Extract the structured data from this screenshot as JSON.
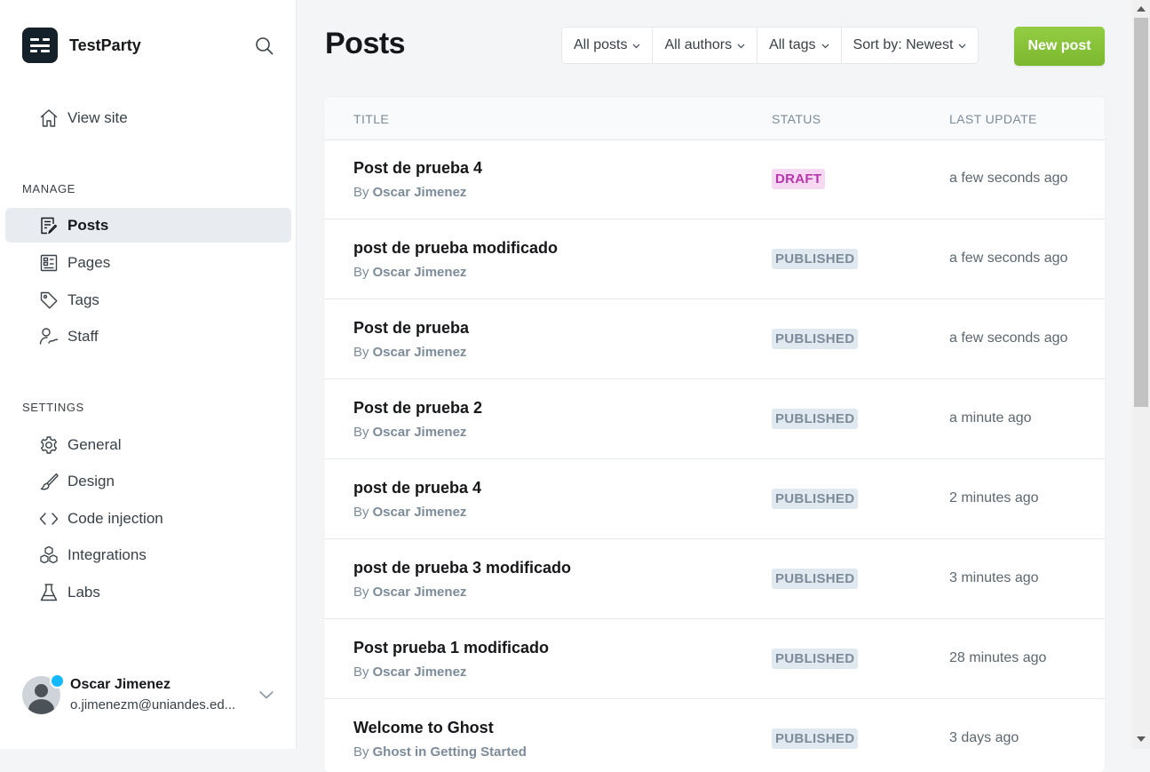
{
  "app": {
    "site_name": "TestParty"
  },
  "sidebar": {
    "view_site": "View site",
    "manage_label": "MANAGE",
    "manage_items": [
      {
        "label": "Posts",
        "icon": "posts-icon",
        "active": true
      },
      {
        "label": "Pages",
        "icon": "pages-icon"
      },
      {
        "label": "Tags",
        "icon": "tag-icon"
      },
      {
        "label": "Staff",
        "icon": "staff-icon"
      }
    ],
    "settings_label": "SETTINGS",
    "settings_items": [
      {
        "label": "General",
        "icon": "gear-icon"
      },
      {
        "label": "Design",
        "icon": "brush-icon"
      },
      {
        "label": "Code injection",
        "icon": "code-icon"
      },
      {
        "label": "Integrations",
        "icon": "integrations-icon"
      },
      {
        "label": "Labs",
        "icon": "flask-icon"
      }
    ],
    "user": {
      "name": "Oscar Jimenez",
      "email": "o.jimenezm@uniandes.ed..."
    }
  },
  "main": {
    "title": "Posts",
    "filters": {
      "type": "All posts",
      "authors": "All authors",
      "tags": "All tags",
      "sort": "Sort by: Newest"
    },
    "new_post_label": "New post",
    "table": {
      "headers": {
        "title": "TITLE",
        "status": "STATUS",
        "updated": "LAST UPDATE"
      },
      "by_prefix": "By",
      "rows": [
        {
          "title": "Post de prueba 4",
          "author": "Oscar Jimenez",
          "status": "DRAFT",
          "updated": "a few seconds ago"
        },
        {
          "title": "post de prueba modificado",
          "author": "Oscar Jimenez",
          "status": "PUBLISHED",
          "updated": "a few seconds ago"
        },
        {
          "title": "Post de prueba",
          "author": "Oscar Jimenez",
          "status": "PUBLISHED",
          "updated": "a few seconds ago"
        },
        {
          "title": "Post de prueba 2",
          "author": "Oscar Jimenez",
          "status": "PUBLISHED",
          "updated": "a minute ago"
        },
        {
          "title": "post de prueba 4",
          "author": "Oscar Jimenez",
          "status": "PUBLISHED",
          "updated": "2 minutes ago"
        },
        {
          "title": "post de prueba 3 modificado",
          "author": "Oscar Jimenez",
          "status": "PUBLISHED",
          "updated": "3 minutes ago"
        },
        {
          "title": "Post prueba 1 modificado",
          "author": "Oscar Jimenez",
          "status": "PUBLISHED",
          "updated": "28 minutes ago"
        },
        {
          "title": "Welcome to Ghost",
          "author": "Ghost in Getting Started",
          "status": "PUBLISHED",
          "updated": "3 days ago"
        }
      ]
    }
  },
  "colors": {
    "accent": "#8ac73c",
    "draft_bg": "#f6d8f2",
    "draft_text": "#b836ab",
    "published_bg": "#e1e9f0",
    "published_text": "#7c8b9a"
  }
}
